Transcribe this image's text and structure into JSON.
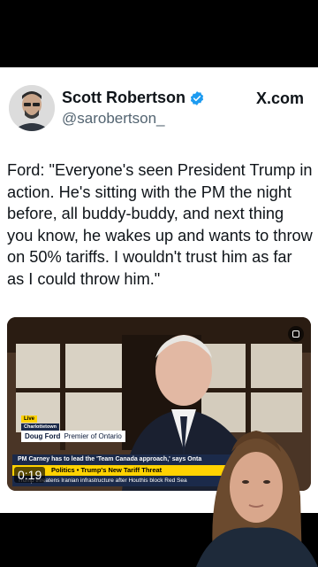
{
  "tweet": {
    "author_name": "Scott Robertson",
    "author_handle": "@sarobertson_",
    "platform": "X.com",
    "text": "Ford: \"Everyone's seen President Trump in action. He's sitting with the PM the night before, all buddy-buddy, and next thing you know, he wakes up and wants to throw on 50% tariffs. I wouldn't trust him as far as I could throw him.\""
  },
  "video": {
    "timestamp": "0:19",
    "live_tag": "Live",
    "location": "Charlottetown",
    "speaker_name": "Doug Ford",
    "speaker_title": "Premier of Ontario",
    "ticker_top": "PM Carney has to lead the 'Team Canada approach,' says Onta",
    "ticker_mid_section": "Politics",
    "ticker_mid_headline": "Trump's New Tariff Threat",
    "ticker_bottom": "Trump threatens Iranian infrastructure after Houthis block Red Sea"
  },
  "colors": {
    "verified": "#1d9bf0",
    "ticker_yellow": "#ffd200",
    "ticker_navy": "#1b2a4a"
  },
  "icons": [
    "verified-badge-icon",
    "instagram-icon",
    "x-logo"
  ]
}
